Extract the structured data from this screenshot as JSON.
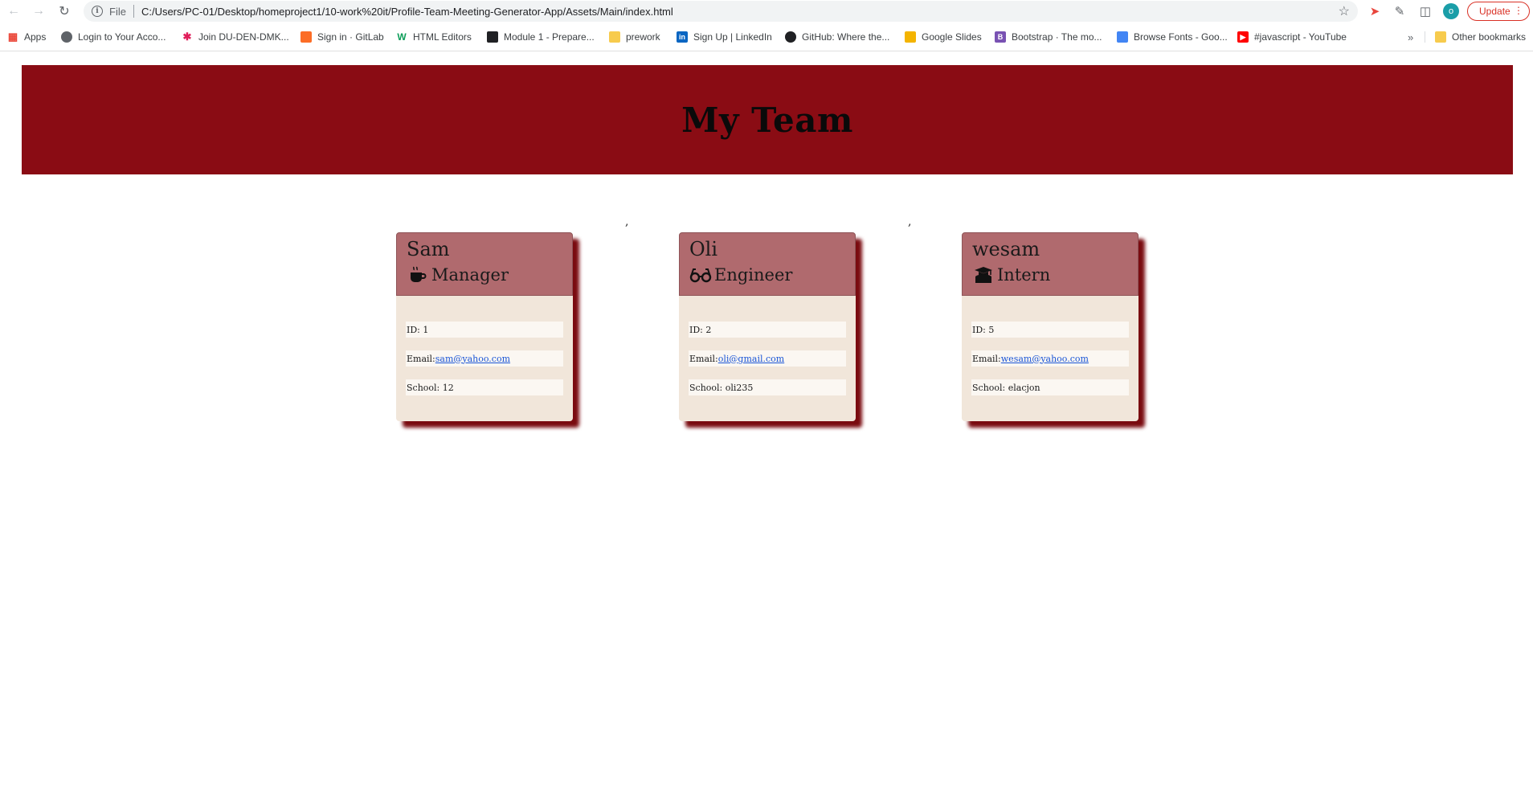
{
  "browser": {
    "scheme_label": "File",
    "url": "C:/Users/PC-01/Desktop/homeproject1/10-work%20it/Profile-Team-Meeting-Generator-App/Assets/Main/index.html",
    "profile_initial": "o",
    "update_label": "Update",
    "bookmarks": [
      {
        "label": "Apps",
        "icon": "apps-grid-icon",
        "color": "#ea4335"
      },
      {
        "label": "Login to Your Acco...",
        "icon": "globe-icon",
        "color": "#5f6368"
      },
      {
        "label": "Join DU-DEN-DMK...",
        "icon": "slack-icon",
        "color": "#e01e5a"
      },
      {
        "label": "Sign in · GitLab",
        "icon": "gitlab-icon",
        "color": "#fc6d26"
      },
      {
        "label": "HTML Editors",
        "icon": "w-icon",
        "color": "#0c9d58"
      },
      {
        "label": "Module 1 - Prepare...",
        "icon": "book-icon",
        "color": "#202124"
      },
      {
        "label": "prework",
        "icon": "folder-icon",
        "color": "#f7cb4d"
      },
      {
        "label": "Sign Up | LinkedIn",
        "icon": "linkedin-icon",
        "color": "#0a66c2"
      },
      {
        "label": "GitHub: Where the...",
        "icon": "github-icon",
        "color": "#202124"
      },
      {
        "label": "Google Slides",
        "icon": "slides-icon",
        "color": "#f4b400"
      },
      {
        "label": "Bootstrap · The mo...",
        "icon": "bootstrap-icon",
        "color": "#7952b3"
      },
      {
        "label": "Browse Fonts - Goo...",
        "icon": "fonts-icon",
        "color": "#4285f4"
      },
      {
        "label": "#javascript - YouTube",
        "icon": "youtube-icon",
        "color": "#ff0000"
      }
    ],
    "other_bookmarks": "Other bookmarks"
  },
  "page": {
    "title": "My Team",
    "separator": ","
  },
  "team": [
    {
      "name": "Sam",
      "role": "Manager",
      "role_icon": "coffee-mug-icon",
      "id_text": "ID: 1",
      "email_prefix": "Email: ",
      "email": "sam@yahoo.com",
      "extra_text": "School: 12"
    },
    {
      "name": "Oli",
      "role": "Engineer",
      "role_icon": "glasses-icon",
      "id_text": "ID: 2",
      "email_prefix": "Email: ",
      "email": "oli@gmail.com",
      "extra_text": "School: oli235"
    },
    {
      "name": "wesam",
      "role": "Intern",
      "role_icon": "graduate-icon",
      "id_text": "ID: 5",
      "email_prefix": "Email: ",
      "email": "wesam@yahoo.com",
      "extra_text": "School: elacjon"
    }
  ],
  "colors": {
    "jumbotron": "#8a0c14",
    "card_header": "#b06a6e",
    "card_body": "#f1e6da",
    "card_shadow": "#7a0b10"
  }
}
